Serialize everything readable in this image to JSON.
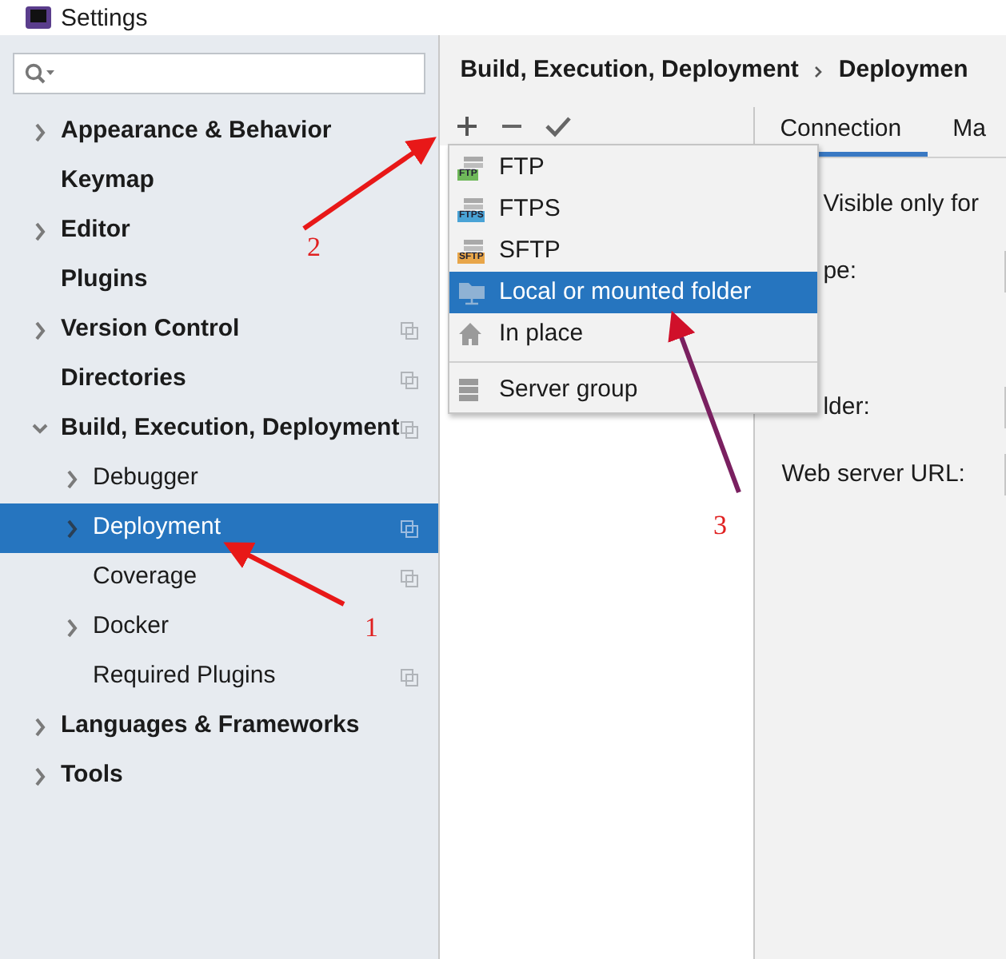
{
  "window": {
    "title": "Settings"
  },
  "tree": [
    {
      "kind": "group",
      "label": "Appearance & Behavior",
      "expanded": false,
      "selected": false,
      "project_level": false
    },
    {
      "kind": "leaf",
      "label": "Keymap",
      "selected": false,
      "project_level": false
    },
    {
      "kind": "group",
      "label": "Editor",
      "expanded": false,
      "selected": false,
      "project_level": false
    },
    {
      "kind": "leaf",
      "label": "Plugins",
      "selected": false,
      "project_level": false
    },
    {
      "kind": "group",
      "label": "Version Control",
      "expanded": false,
      "selected": false,
      "project_level": true
    },
    {
      "kind": "leaf",
      "label": "Directories",
      "selected": false,
      "project_level": true
    },
    {
      "kind": "group",
      "label": "Build, Execution, Deployment",
      "expanded": true,
      "selected": false,
      "project_level": true,
      "children": [
        {
          "kind": "group",
          "label": "Debugger",
          "expanded": false,
          "selected": false,
          "project_level": false
        },
        {
          "kind": "group",
          "label": "Deployment",
          "expanded": false,
          "selected": true,
          "project_level": true
        },
        {
          "kind": "leaf",
          "label": "Coverage",
          "selected": false,
          "project_level": true
        },
        {
          "kind": "group",
          "label": "Docker",
          "expanded": false,
          "selected": false,
          "project_level": false
        },
        {
          "kind": "leaf",
          "label": "Required Plugins",
          "selected": false,
          "project_level": true
        }
      ]
    },
    {
      "kind": "group",
      "label": "Languages & Frameworks",
      "expanded": false,
      "selected": false,
      "project_level": false
    },
    {
      "kind": "group",
      "label": "Tools",
      "expanded": false,
      "selected": false,
      "project_level": false
    }
  ],
  "breadcrumb": [
    "Build, Execution, Deployment",
    "Deploymen"
  ],
  "add_menu": [
    {
      "kind": "server",
      "label": "FTP",
      "badge": "FTP",
      "color": "#6fb85a",
      "selected": false
    },
    {
      "kind": "server",
      "label": "FTPS",
      "badge": "FTPS",
      "color": "#4aa3d6",
      "selected": false
    },
    {
      "kind": "server",
      "label": "SFTP",
      "badge": "SFTP",
      "color": "#e8a64a",
      "selected": false
    },
    {
      "kind": "folder",
      "label": "Local or mounted folder",
      "selected": true
    },
    {
      "kind": "home",
      "label": "In place",
      "selected": false
    },
    {
      "kind": "group",
      "label": "Server group",
      "selected": false
    }
  ],
  "tabs": [
    {
      "label": "Connection",
      "selected": true
    },
    {
      "label": "Ma",
      "selected": false
    }
  ],
  "form": [
    {
      "kind": "check",
      "label": "Visible only for"
    },
    {
      "kind": "field",
      "label": "pe:"
    },
    {
      "kind": "spacer"
    },
    {
      "kind": "field",
      "label": "lder:"
    },
    {
      "kind": "field",
      "label": "Web server URL:"
    }
  ],
  "annotations": [
    {
      "label": "1"
    },
    {
      "label": "2"
    },
    {
      "label": "3"
    }
  ]
}
